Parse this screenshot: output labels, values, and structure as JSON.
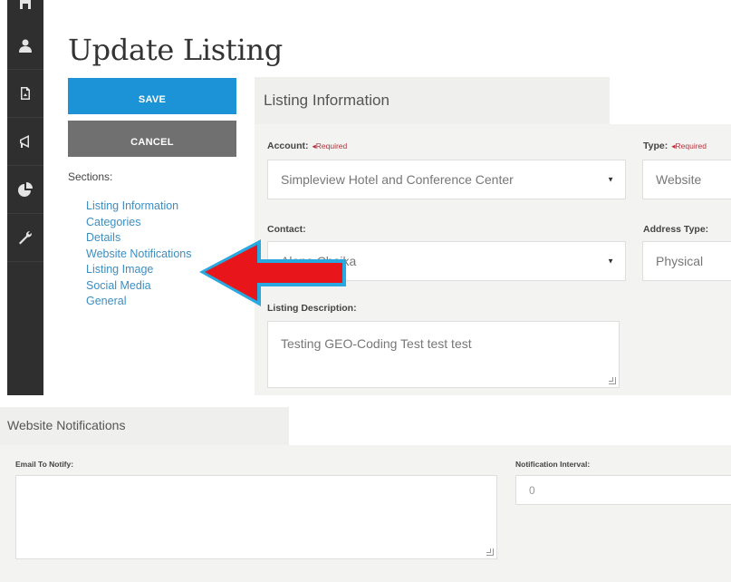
{
  "sidebar_icons": [
    "home-icon",
    "user-icon",
    "document-icon",
    "megaphone-icon",
    "pie-chart-icon",
    "wrench-icon"
  ],
  "page": {
    "title": "Update Listing"
  },
  "actions": {
    "save_label": "SAVE",
    "cancel_label": "CANCEL"
  },
  "sections": {
    "label": "Sections:",
    "items": [
      "Listing Information",
      "Categories",
      "Details",
      "Website Notifications",
      "Listing Image",
      "Social Media",
      "General"
    ]
  },
  "listing_information": {
    "title": "Listing Information",
    "required_text": "◂Required",
    "account": {
      "label": "Account:",
      "value": "Simpleview Hotel and Conference Center"
    },
    "type": {
      "label": "Type:",
      "value": "Website"
    },
    "contact": {
      "label": "Contact:",
      "value": "Alena Chaika"
    },
    "address_type": {
      "label": "Address Type:",
      "value": "Physical"
    },
    "description": {
      "label": "Listing Description:",
      "value": "Testing GEO-Coding Test test test"
    }
  },
  "website_notifications": {
    "title": "Website Notifications",
    "email_label": "Email To Notify:",
    "email_value": "",
    "interval_label": "Notification Interval:",
    "interval_value": "0"
  },
  "annotation": {
    "color": "#e8151b",
    "outline": "#29a9e0",
    "points_to": "Website Notifications"
  }
}
